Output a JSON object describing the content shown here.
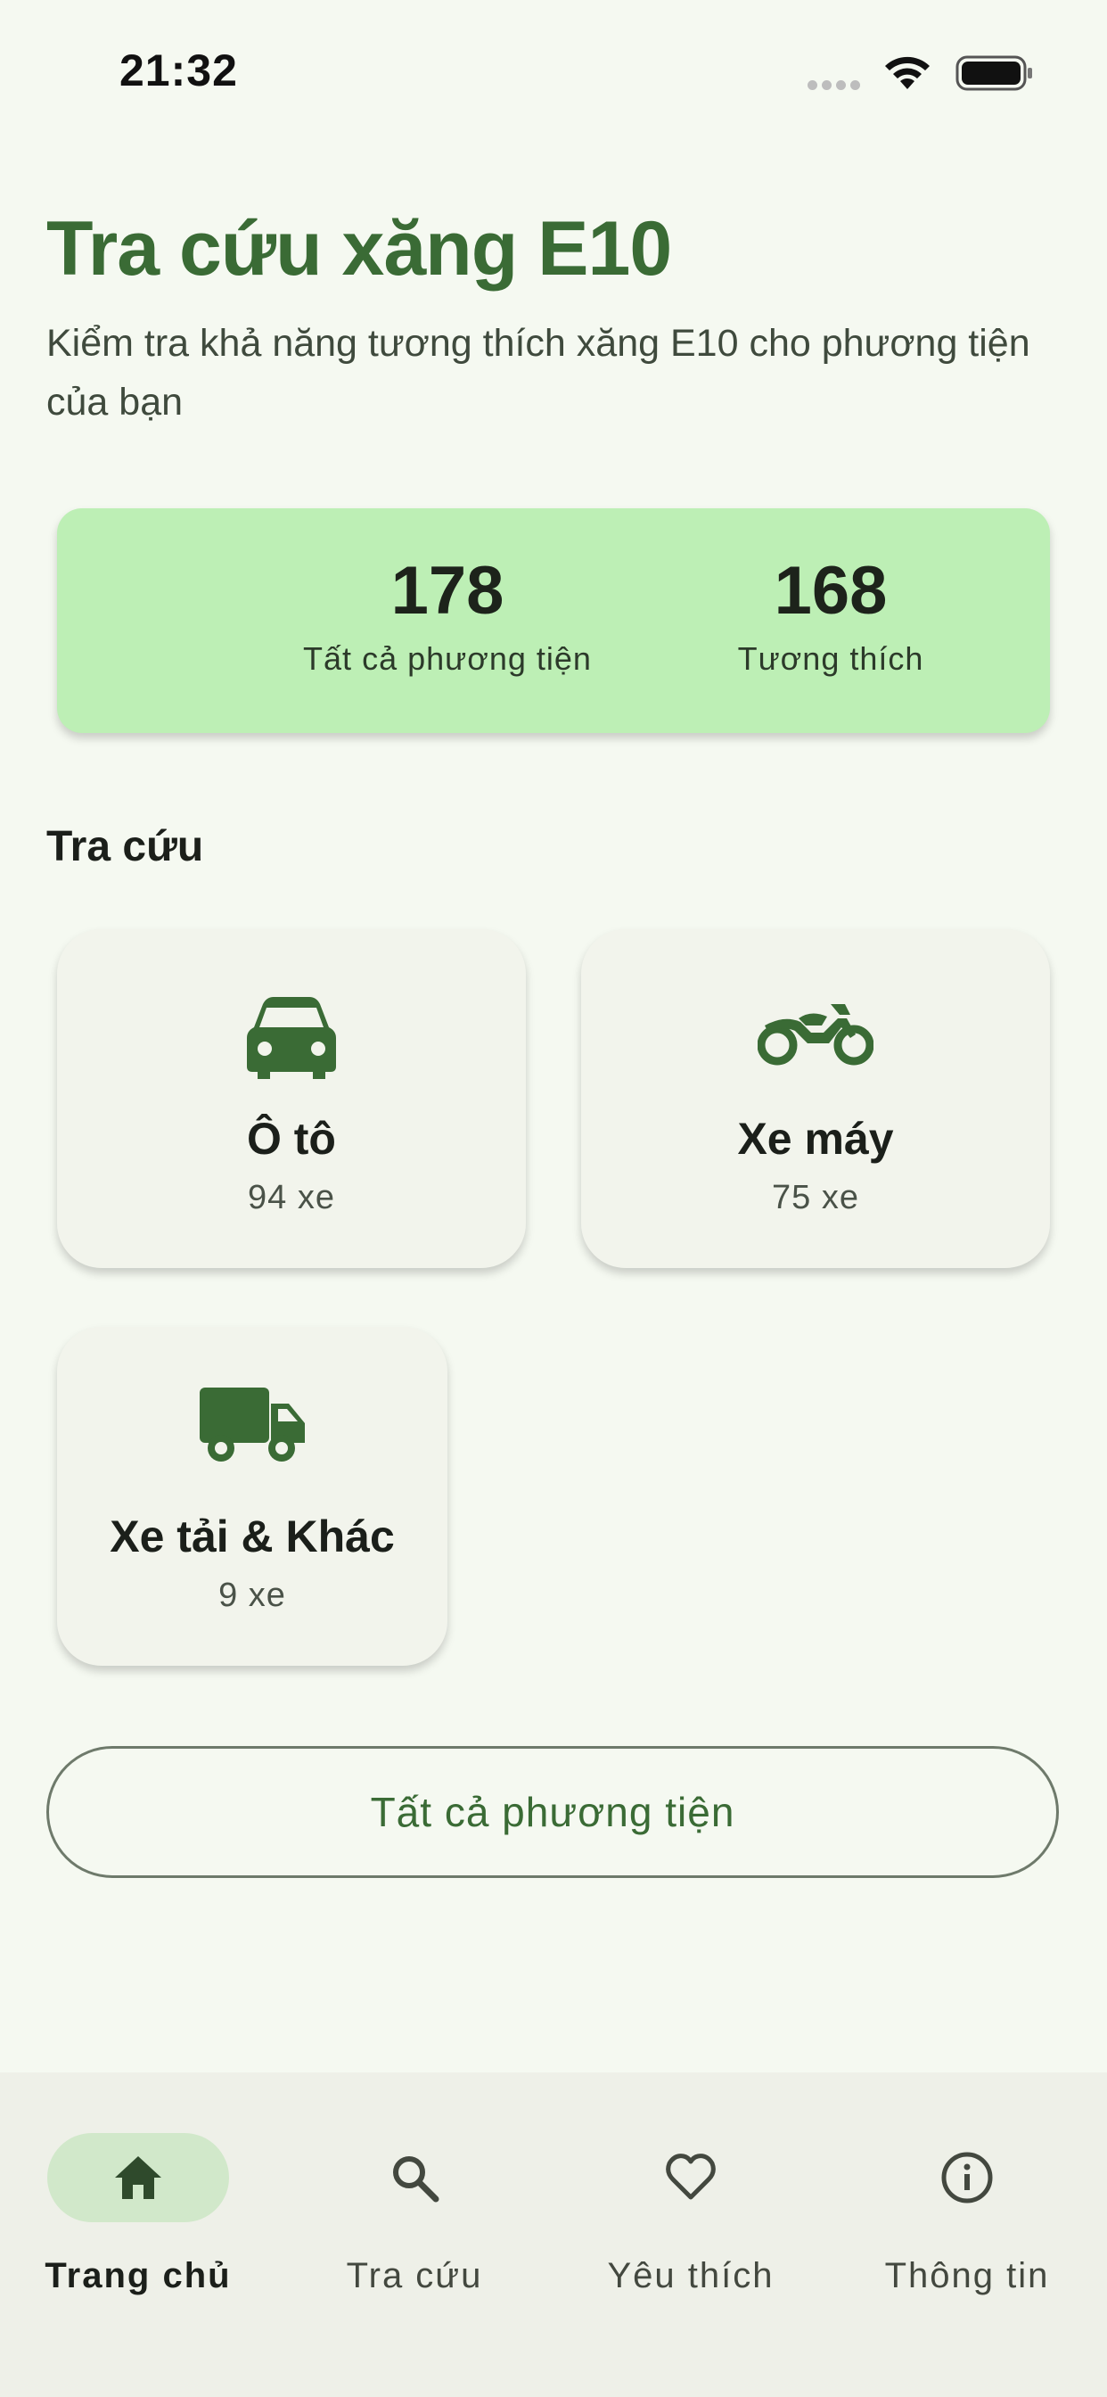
{
  "status_bar": {
    "time": "21:32"
  },
  "header": {
    "title": "Tra cứu xăng E10",
    "subtitle": "Kiểm tra khả năng tương thích xăng E10 cho phương tiện của bạn"
  },
  "stats": {
    "total_count": "178",
    "total_label": "Tất cả phương tiện",
    "compatible_count": "168",
    "compatible_label": "Tương thích"
  },
  "lookup": {
    "section_label": "Tra cứu",
    "categories": [
      {
        "name": "Ô tô",
        "count": "94 xe",
        "icon": "car-icon"
      },
      {
        "name": "Xe máy",
        "count": "75 xe",
        "icon": "motorcycle-icon"
      },
      {
        "name": "Xe tải & Khác",
        "count": "9 xe",
        "icon": "truck-icon"
      }
    ],
    "all_vehicles_button": "Tất cả phương tiện"
  },
  "bottom_nav": {
    "items": [
      {
        "label": "Trang chủ",
        "icon": "home-icon",
        "active": true
      },
      {
        "label": "Tra cứu",
        "icon": "search-icon",
        "active": false
      },
      {
        "label": "Yêu thích",
        "icon": "heart-icon",
        "active": false
      },
      {
        "label": "Thông tin",
        "icon": "info-icon",
        "active": false
      }
    ]
  },
  "colors": {
    "background": "#F5F9F1",
    "primary": "#3A6B35",
    "stats_card": "#BDEFB5",
    "category_card": "#F2F4EC",
    "nav_active_pill": "#D1E8CA",
    "nav_background": "#EEF0E8"
  }
}
